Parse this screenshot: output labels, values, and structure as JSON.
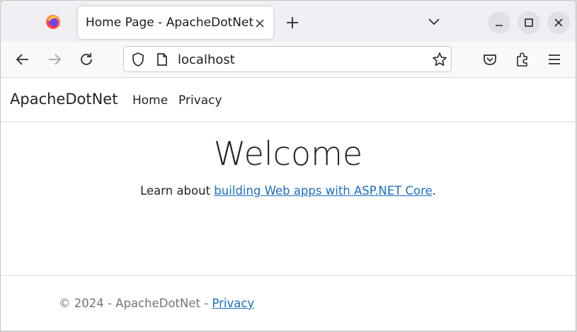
{
  "browser": {
    "tab_title": "Home Page - ApacheDotNet",
    "url": "localhost",
    "icons": [
      "firefox-icon",
      "close-icon",
      "plus-icon",
      "chevron-down-icon",
      "minimize-icon",
      "maximize-icon",
      "close-window-icon",
      "back-arrow-icon",
      "forward-arrow-icon",
      "reload-icon",
      "shield-icon",
      "page-icon",
      "star-icon",
      "pocket-icon",
      "extensions-icon",
      "menu-icon"
    ]
  },
  "site": {
    "brand": "ApacheDotNet",
    "nav": [
      {
        "label": "Home"
      },
      {
        "label": "Privacy"
      }
    ],
    "hero": {
      "title": "Welcome",
      "text_before": "Learn about ",
      "link": "building Web apps with ASP.NET Core",
      "text_after": "."
    },
    "footer": {
      "copyright": "© 2024 - ApacheDotNet - ",
      "link": "Privacy"
    }
  },
  "colors": {
    "link": "#1b6ec2",
    "text": "#212529",
    "muted": "#6c757d",
    "tabstrip_bg": "#f0f0f4"
  }
}
